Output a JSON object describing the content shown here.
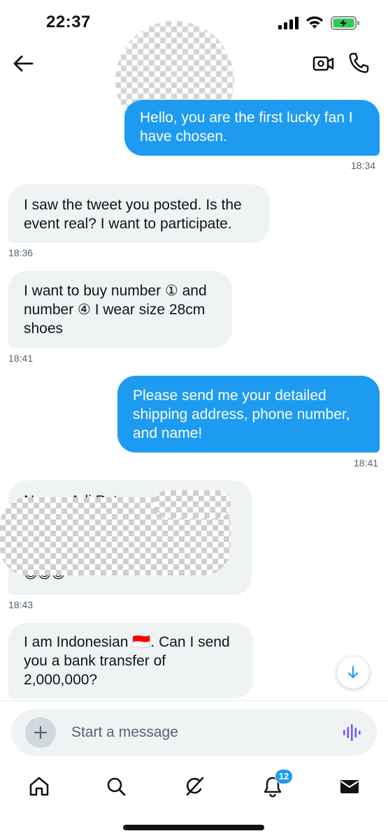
{
  "status_bar": {
    "time": "22:37",
    "battery_state": "charging"
  },
  "header": {
    "back_icon": "arrow-left-icon",
    "video_icon": "video-camera-icon",
    "call_icon": "phone-icon"
  },
  "messages": [
    {
      "direction": "out",
      "text": "Hello, you are the first lucky fan I have chosen.",
      "time": "18:34"
    },
    {
      "direction": "in",
      "text": "I saw the tweet you posted. Is the event real? I want to participate.",
      "time": "18:36"
    },
    {
      "direction": "in",
      "text": "I want to buy number ① and number ④ I wear size 28cm shoes",
      "time": "18:41"
    },
    {
      "direction": "out",
      "text": "Please send me your detailed shipping address, phone number, and name!",
      "time": "18:41"
    },
    {
      "direction": "in",
      "text_line1": "Name: Adi Putra",
      "text_line2": "😇😇😇",
      "time": "18:43"
    },
    {
      "direction": "in",
      "text": "I am Indonesian 🇮🇩. Can I send you a bank transfer of 2,000,000?"
    }
  ],
  "composer": {
    "placeholder": "Start a message",
    "add_icon": "plus-icon",
    "voice_icon": "voice-waveform-icon"
  },
  "nav": {
    "items": [
      "home-icon",
      "search-icon",
      "grok-icon",
      "notifications-bell-icon",
      "messages-envelope-icon"
    ],
    "notifications_badge": "12"
  },
  "colors": {
    "accent": "#1d9bf0",
    "incoming_bubble": "#eff3f4",
    "text": "#0f1419",
    "secondary_text": "#536471",
    "voice": "#7856ff"
  }
}
